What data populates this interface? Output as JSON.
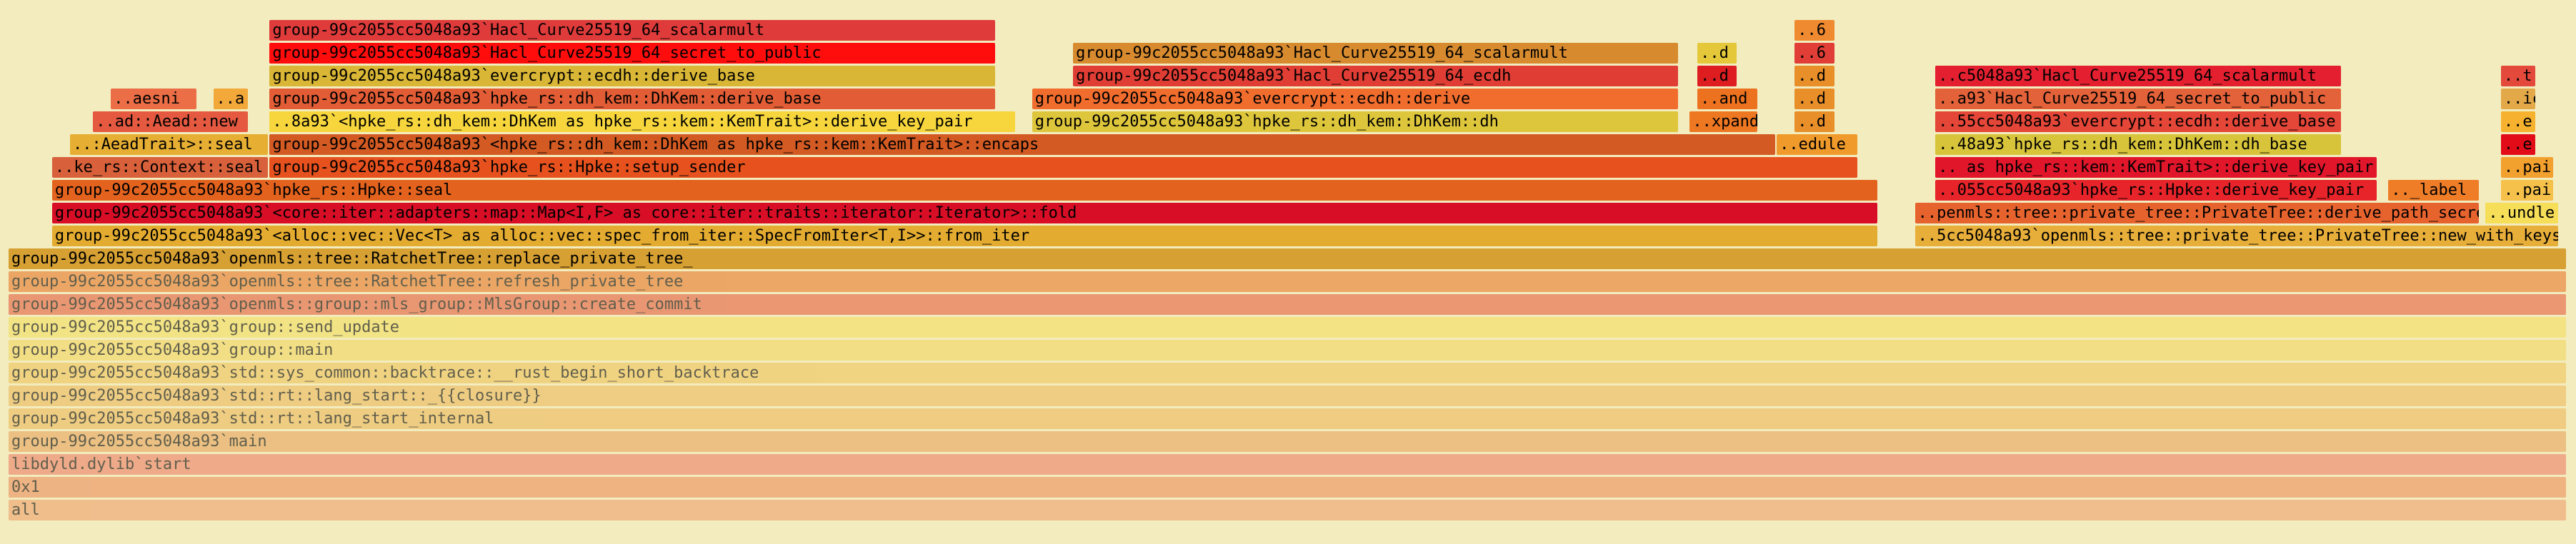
{
  "chart_data": {
    "type": "flamegraph",
    "frames": [
      {
        "label": "all",
        "start": 0.0,
        "end": 1.0,
        "depth": 0,
        "color": "#eea06a",
        "faded": true
      },
      {
        "label": "0x1",
        "start": 0.0,
        "end": 1.0,
        "depth": 1,
        "color": "#ed8e5a",
        "faded": true
      },
      {
        "label": "libdyld.dylib`start",
        "start": 0.0,
        "end": 1.0,
        "depth": 2,
        "color": "#ec7f66",
        "faded": true
      },
      {
        "label": "group-99c2055cc5048a93`main",
        "start": 0.0,
        "end": 1.0,
        "depth": 3,
        "color": "#e8a35a",
        "faded": true
      },
      {
        "label": "group-99c2055cc5048a93`std::rt::lang_start_internal",
        "start": 0.0,
        "end": 1.0,
        "depth": 4,
        "color": "#ecb858",
        "faded": true
      },
      {
        "label": "group-99c2055cc5048a93`std::rt::lang_start::_{{closure}}",
        "start": 0.0,
        "end": 1.0,
        "depth": 5,
        "color": "#edb95c",
        "faded": true
      },
      {
        "label": "group-99c2055cc5048a93`std::sys_common::backtrace::__rust_begin_short_backtrace",
        "start": 0.0,
        "end": 1.0,
        "depth": 6,
        "color": "#f0c458",
        "faded": true
      },
      {
        "label": "group-99c2055cc5048a93`group::main",
        "start": 0.0,
        "end": 1.0,
        "depth": 7,
        "color": "#f2d65e",
        "faded": true
      },
      {
        "label": "group-99c2055cc5048a93`group::send_update",
        "start": 0.0,
        "end": 1.0,
        "depth": 8,
        "color": "#f3de5e",
        "faded": true
      },
      {
        "label": "group-99c2055cc5048a93`openmls::group::mls_group::MlsGroup::create_commit",
        "start": 0.0,
        "end": 1.0,
        "depth": 9,
        "color": "#e45f3f",
        "faded": true
      },
      {
        "label": "group-99c2055cc5048a93`openmls::tree::RatchetTree::refresh_private_tree",
        "start": 0.0,
        "end": 1.0,
        "depth": 10,
        "color": "#e7782a",
        "faded": true
      },
      {
        "label": "group-99c2055cc5048a93`openmls::tree::RatchetTree::replace_private_tree_",
        "start": 0.0,
        "end": 1.0,
        "depth": 11,
        "color": "#d6a032"
      },
      {
        "label": "group-99c2055cc5048a93`<alloc::vec::Vec<T> as alloc::vec::spec_from_iter::SpecFromIter<T,I>>::from_iter",
        "start": 0.017,
        "end": 0.731,
        "depth": 12,
        "color": "#e3ab30"
      },
      {
        "label": "group-99c2055cc5048a93`<core::iter::adapters::map::Map<I,F> as core::iter::traits::iterator::Iterator>::fold",
        "start": 0.017,
        "end": 0.731,
        "depth": 13,
        "color": "#d80e26"
      },
      {
        "label": "group-99c2055cc5048a93`hpke_rs::Hpke::seal",
        "start": 0.017,
        "end": 0.731,
        "depth": 14,
        "color": "#e3621e"
      },
      {
        "label": "..ke_rs::Context::seal",
        "start": 0.017,
        "end": 0.102,
        "depth": 15,
        "color": "#d8603a"
      },
      {
        "label": "group-99c2055cc5048a93`hpke_rs::Hpke::setup_sender",
        "start": 0.102,
        "end": 0.723,
        "depth": 15,
        "color": "#e6511e"
      },
      {
        "label": "..:AeadTrait>::seal",
        "start": 0.024,
        "end": 0.102,
        "depth": 16,
        "color": "#e6ae33"
      },
      {
        "label": "group-99c2055cc5048a93`<hpke_rs::dh_kem::DhKem as hpke_rs::kem::KemTrait>::encaps",
        "start": 0.102,
        "end": 0.691,
        "depth": 16,
        "color": "#d35a22"
      },
      {
        "label": "..edule",
        "start": 0.691,
        "end": 0.723,
        "depth": 16,
        "color": "#f09a2c"
      },
      {
        "label": "..ad::Aead::new",
        "start": 0.033,
        "end": 0.094,
        "depth": 17,
        "color": "#e55940"
      },
      {
        "label": "..8a93`<hpke_rs::dh_kem::DhKem as hpke_rs::kem::KemTrait>::derive_key_pair",
        "start": 0.102,
        "end": 0.394,
        "depth": 17,
        "color": "#f6d63c"
      },
      {
        "label": "group-99c2055cc5048a93`hpke_rs::dh_kem::DhKem::dh",
        "start": 0.4,
        "end": 0.653,
        "depth": 17,
        "color": "#dec63c"
      },
      {
        "label": "..xpand",
        "start": 0.657,
        "end": 0.684,
        "depth": 17,
        "color": "#ee7722"
      },
      {
        "label": "..d",
        "start": 0.698,
        "end": 0.714,
        "depth": 17,
        "color": "#e88f2a"
      },
      {
        "label": "..aesni",
        "start": 0.04,
        "end": 0.074,
        "depth": 18,
        "color": "#ec6e46"
      },
      {
        "label": "..a",
        "start": 0.08,
        "end": 0.094,
        "depth": 18,
        "color": "#f3a83a"
      },
      {
        "label": "group-99c2055cc5048a93`hpke_rs::dh_kem::DhKem::derive_base",
        "start": 0.102,
        "end": 0.386,
        "depth": 18,
        "color": "#e25d35"
      },
      {
        "label": "group-99c2055cc5048a93`evercrypt::ecdh::derive",
        "start": 0.4,
        "end": 0.653,
        "depth": 18,
        "color": "#f16d2e"
      },
      {
        "label": "..and",
        "start": 0.66,
        "end": 0.684,
        "depth": 18,
        "color": "#ec7220"
      },
      {
        "label": "..d",
        "start": 0.698,
        "end": 0.714,
        "depth": 18,
        "color": "#e88f2a"
      },
      {
        "label": "group-99c2055cc5048a93`evercrypt::ecdh::derive_base",
        "start": 0.102,
        "end": 0.386,
        "depth": 19,
        "color": "#d9b635"
      },
      {
        "label": "group-99c2055cc5048a93`Hacl_Curve25519_64_ecdh",
        "start": 0.416,
        "end": 0.653,
        "depth": 19,
        "color": "#e03d34"
      },
      {
        "label": "..d",
        "start": 0.66,
        "end": 0.676,
        "depth": 19,
        "color": "#dd1d20"
      },
      {
        "label": "..d",
        "start": 0.698,
        "end": 0.714,
        "depth": 19,
        "color": "#e88f2a"
      },
      {
        "label": "group-99c2055cc5048a93`Hacl_Curve25519_64_secret_to_public",
        "start": 0.102,
        "end": 0.386,
        "depth": 20,
        "color": "#ff0d0d"
      },
      {
        "label": "group-99c2055cc5048a93`Hacl_Curve25519_64_scalarmult",
        "start": 0.416,
        "end": 0.653,
        "depth": 20,
        "color": "#d78a2e"
      },
      {
        "label": "..d",
        "start": 0.66,
        "end": 0.676,
        "depth": 20,
        "color": "#e4c83a"
      },
      {
        "label": "..6",
        "start": 0.698,
        "end": 0.714,
        "depth": 20,
        "color": "#e03e36"
      },
      {
        "label": "group-99c2055cc5048a93`Hacl_Curve25519_64_scalarmult",
        "start": 0.102,
        "end": 0.386,
        "depth": 21,
        "color": "#e03b3b"
      },
      {
        "label": "..6",
        "start": 0.698,
        "end": 0.714,
        "depth": 21,
        "color": "#f08a30"
      },
      {
        "label": "..5cc5048a93`openmls::tree::private_tree::PrivateTree::new_with_keys",
        "start": 0.745,
        "end": 0.997,
        "depth": 12,
        "color": "#e7ae3a"
      },
      {
        "label": "..penmls::tree::private_tree::PrivateTree::derive_path_secrets",
        "start": 0.745,
        "end": 0.966,
        "depth": 13,
        "color": "#e7632e"
      },
      {
        "label": "..undle",
        "start": 0.968,
        "end": 0.997,
        "depth": 13,
        "color": "#f6de58"
      },
      {
        "label": "..055cc5048a93`hpke_rs::Hpke::derive_key_pair",
        "start": 0.753,
        "end": 0.926,
        "depth": 14,
        "color": "#e6242a"
      },
      {
        "label": ".._label",
        "start": 0.93,
        "end": 0.966,
        "depth": 14,
        "color": "#ef7d28"
      },
      {
        "label": "..pair",
        "start": 0.974,
        "end": 0.995,
        "depth": 14,
        "color": "#f5c14a"
      },
      {
        "label": ".. as hpke_rs::kem::KemTrait>::derive_key_pair",
        "start": 0.753,
        "end": 0.926,
        "depth": 15,
        "color": "#e2162a"
      },
      {
        "label": "..pair",
        "start": 0.974,
        "end": 0.995,
        "depth": 15,
        "color": "#f2a02e"
      },
      {
        "label": "..48a93`hpke_rs::dh_kem::DhKem::dh_base",
        "start": 0.753,
        "end": 0.912,
        "depth": 16,
        "color": "#d8c43a"
      },
      {
        "label": "..e",
        "start": 0.974,
        "end": 0.988,
        "depth": 16,
        "color": "#e20c18"
      },
      {
        "label": "..55cc5048a93`evercrypt::ecdh::derive_base",
        "start": 0.753,
        "end": 0.912,
        "depth": 17,
        "color": "#e44638"
      },
      {
        "label": "..e",
        "start": 0.974,
        "end": 0.988,
        "depth": 17,
        "color": "#f6b22e"
      },
      {
        "label": "..a93`Hacl_Curve25519_64_secret_to_public",
        "start": 0.753,
        "end": 0.912,
        "depth": 18,
        "color": "#e3623a"
      },
      {
        "label": "..ic",
        "start": 0.974,
        "end": 0.988,
        "depth": 18,
        "color": "#e3a848"
      },
      {
        "label": "..c5048a93`Hacl_Curve25519_64_scalarmult",
        "start": 0.753,
        "end": 0.912,
        "depth": 19,
        "color": "#e42030"
      },
      {
        "label": "..t",
        "start": 0.974,
        "end": 0.988,
        "depth": 19,
        "color": "#e44a3c"
      }
    ]
  }
}
